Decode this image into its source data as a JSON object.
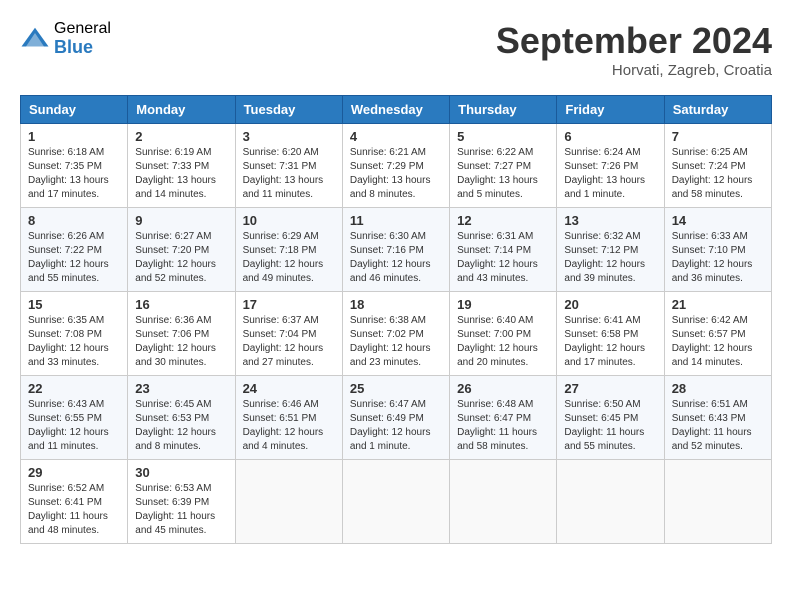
{
  "header": {
    "logo_general": "General",
    "logo_blue": "Blue",
    "month_title": "September 2024",
    "subtitle": "Horvati, Zagreb, Croatia"
  },
  "weekdays": [
    "Sunday",
    "Monday",
    "Tuesday",
    "Wednesday",
    "Thursday",
    "Friday",
    "Saturday"
  ],
  "weeks": [
    [
      {
        "day": "1",
        "sunrise": "6:18 AM",
        "sunset": "7:35 PM",
        "daylight": "13 hours and 17 minutes."
      },
      {
        "day": "2",
        "sunrise": "6:19 AM",
        "sunset": "7:33 PM",
        "daylight": "13 hours and 14 minutes."
      },
      {
        "day": "3",
        "sunrise": "6:20 AM",
        "sunset": "7:31 PM",
        "daylight": "13 hours and 11 minutes."
      },
      {
        "day": "4",
        "sunrise": "6:21 AM",
        "sunset": "7:29 PM",
        "daylight": "13 hours and 8 minutes."
      },
      {
        "day": "5",
        "sunrise": "6:22 AM",
        "sunset": "7:27 PM",
        "daylight": "13 hours and 5 minutes."
      },
      {
        "day": "6",
        "sunrise": "6:24 AM",
        "sunset": "7:26 PM",
        "daylight": "13 hours and 1 minute."
      },
      {
        "day": "7",
        "sunrise": "6:25 AM",
        "sunset": "7:24 PM",
        "daylight": "12 hours and 58 minutes."
      }
    ],
    [
      {
        "day": "8",
        "sunrise": "6:26 AM",
        "sunset": "7:22 PM",
        "daylight": "12 hours and 55 minutes."
      },
      {
        "day": "9",
        "sunrise": "6:27 AM",
        "sunset": "7:20 PM",
        "daylight": "12 hours and 52 minutes."
      },
      {
        "day": "10",
        "sunrise": "6:29 AM",
        "sunset": "7:18 PM",
        "daylight": "12 hours and 49 minutes."
      },
      {
        "day": "11",
        "sunrise": "6:30 AM",
        "sunset": "7:16 PM",
        "daylight": "12 hours and 46 minutes."
      },
      {
        "day": "12",
        "sunrise": "6:31 AM",
        "sunset": "7:14 PM",
        "daylight": "12 hours and 43 minutes."
      },
      {
        "day": "13",
        "sunrise": "6:32 AM",
        "sunset": "7:12 PM",
        "daylight": "12 hours and 39 minutes."
      },
      {
        "day": "14",
        "sunrise": "6:33 AM",
        "sunset": "7:10 PM",
        "daylight": "12 hours and 36 minutes."
      }
    ],
    [
      {
        "day": "15",
        "sunrise": "6:35 AM",
        "sunset": "7:08 PM",
        "daylight": "12 hours and 33 minutes."
      },
      {
        "day": "16",
        "sunrise": "6:36 AM",
        "sunset": "7:06 PM",
        "daylight": "12 hours and 30 minutes."
      },
      {
        "day": "17",
        "sunrise": "6:37 AM",
        "sunset": "7:04 PM",
        "daylight": "12 hours and 27 minutes."
      },
      {
        "day": "18",
        "sunrise": "6:38 AM",
        "sunset": "7:02 PM",
        "daylight": "12 hours and 23 minutes."
      },
      {
        "day": "19",
        "sunrise": "6:40 AM",
        "sunset": "7:00 PM",
        "daylight": "12 hours and 20 minutes."
      },
      {
        "day": "20",
        "sunrise": "6:41 AM",
        "sunset": "6:58 PM",
        "daylight": "12 hours and 17 minutes."
      },
      {
        "day": "21",
        "sunrise": "6:42 AM",
        "sunset": "6:57 PM",
        "daylight": "12 hours and 14 minutes."
      }
    ],
    [
      {
        "day": "22",
        "sunrise": "6:43 AM",
        "sunset": "6:55 PM",
        "daylight": "12 hours and 11 minutes."
      },
      {
        "day": "23",
        "sunrise": "6:45 AM",
        "sunset": "6:53 PM",
        "daylight": "12 hours and 8 minutes."
      },
      {
        "day": "24",
        "sunrise": "6:46 AM",
        "sunset": "6:51 PM",
        "daylight": "12 hours and 4 minutes."
      },
      {
        "day": "25",
        "sunrise": "6:47 AM",
        "sunset": "6:49 PM",
        "daylight": "12 hours and 1 minute."
      },
      {
        "day": "26",
        "sunrise": "6:48 AM",
        "sunset": "6:47 PM",
        "daylight": "11 hours and 58 minutes."
      },
      {
        "day": "27",
        "sunrise": "6:50 AM",
        "sunset": "6:45 PM",
        "daylight": "11 hours and 55 minutes."
      },
      {
        "day": "28",
        "sunrise": "6:51 AM",
        "sunset": "6:43 PM",
        "daylight": "11 hours and 52 minutes."
      }
    ],
    [
      {
        "day": "29",
        "sunrise": "6:52 AM",
        "sunset": "6:41 PM",
        "daylight": "11 hours and 48 minutes."
      },
      {
        "day": "30",
        "sunrise": "6:53 AM",
        "sunset": "6:39 PM",
        "daylight": "11 hours and 45 minutes."
      },
      null,
      null,
      null,
      null,
      null
    ]
  ]
}
